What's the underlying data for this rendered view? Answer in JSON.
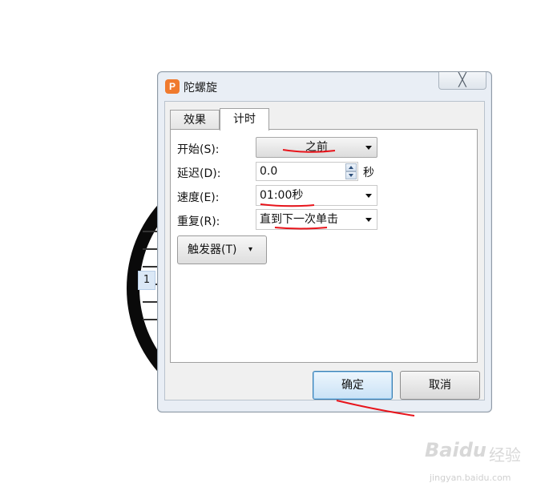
{
  "background": {
    "badge_number": "1"
  },
  "dialog": {
    "title": "陀螺旋",
    "app_icon_letter": "P",
    "close_glyph": "╳",
    "tabs": [
      {
        "label": "效果",
        "selected": false
      },
      {
        "label": "计时",
        "selected": true
      }
    ],
    "fields": {
      "start": {
        "label": "开始(S):",
        "value": "之前"
      },
      "delay": {
        "label": "延迟(D):",
        "value": "0.0",
        "unit": "秒"
      },
      "speed": {
        "label": "速度(E):",
        "value": "01:00秒"
      },
      "repeat": {
        "label": "重复(R):",
        "value": "直到下一次单击"
      }
    },
    "trigger_button": {
      "label": "触发器(T)",
      "caret": "▾"
    },
    "ok_button": "确定",
    "cancel_button": "取消"
  },
  "annotations": {
    "color": "#e8141b"
  },
  "watermark": {
    "logo": "Baidu",
    "cn": "经验",
    "url": "jingyan.baidu.com"
  },
  "colors": {
    "dialog_bg": "#e9eef5",
    "accent_icon": "#f07a2e",
    "ok_border": "#3c7fb1"
  }
}
